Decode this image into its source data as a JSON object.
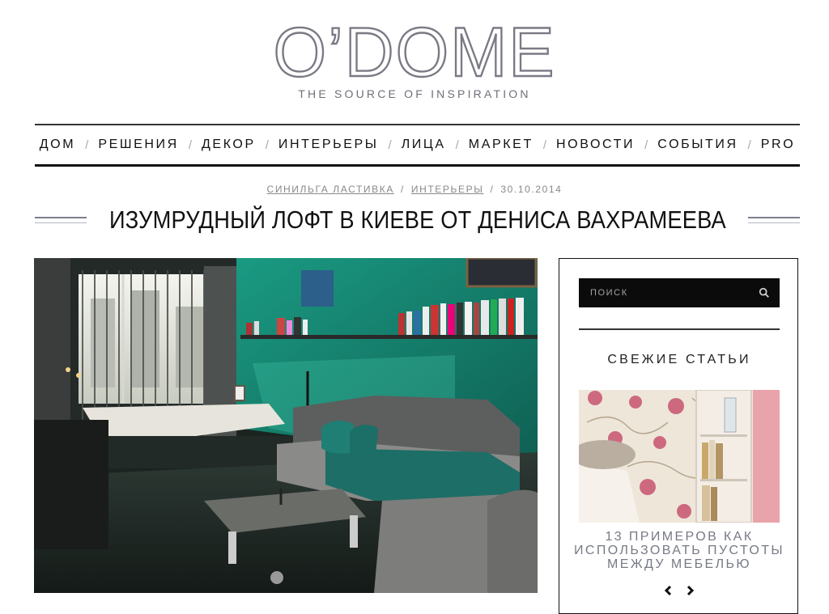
{
  "site": {
    "logo": "O’DOME",
    "tagline": "THE SOURCE OF INSPIRATION"
  },
  "nav": {
    "items": [
      "ДОМ",
      "РЕШЕНИЯ",
      "ДЕКОР",
      "ИНТЕРЬЕРЫ",
      "ЛИЦА",
      "МАРКЕТ",
      "НОВОСТИ",
      "СОБЫТИЯ",
      "PRO"
    ],
    "separator": "/"
  },
  "article": {
    "author": "СИНИЛЬГА ЛАСТИВКА",
    "category": "ИНТЕРЬЕРЫ",
    "date": "30.10.2014",
    "title": "ИЗУМРУДНЫЙ ЛОФТ В КИЕВЕ ОТ ДЕНИСА ВАХРАМЕЕВА"
  },
  "sidebar": {
    "search_placeholder": "ПОИСК",
    "recent_heading": "СВЕЖИЕ СТАТЬИ",
    "recent_post_title": "13 ПРИМЕРОВ КАК ИСПОЛЬЗОВАТЬ ПУСТОТЫ МЕЖДУ МЕБЕЛЬЮ"
  },
  "icons": {
    "search": "search-icon",
    "prev": "chevron-left-icon",
    "next": "chevron-right-icon"
  },
  "colors": {
    "accent_wall": "#1f8f7a",
    "nav_text": "#111111",
    "muted_text": "#777a85",
    "search_bg": "#0b0b0b"
  }
}
